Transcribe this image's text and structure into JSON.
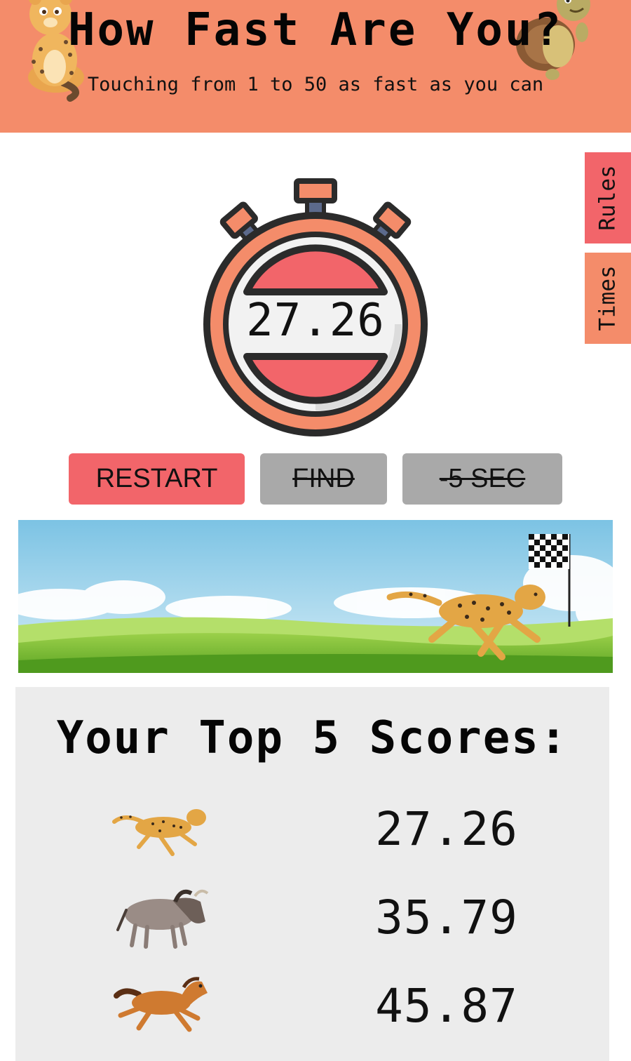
{
  "header": {
    "title": "How Fast Are You?",
    "subtitle": "Touching from 1 to 50 as fast as you can"
  },
  "side_tabs": {
    "rules": "Rules",
    "times": "Times"
  },
  "timer": {
    "value": "27.26"
  },
  "buttons": {
    "restart": "RESTART",
    "find": "FIND",
    "five_sec": "-5 SEC"
  },
  "scores": {
    "title": "Your Top 5 Scores:",
    "rows": [
      {
        "animal": "cheetah",
        "value": "27.26"
      },
      {
        "animal": "wildebeest",
        "value": "35.79"
      },
      {
        "animal": "horse",
        "value": "45.87"
      }
    ]
  },
  "colors": {
    "header_bg": "#f48c6a",
    "accent_red": "#f2656a",
    "disabled_gray": "#a9a9a9",
    "panel_bg": "#ececec"
  },
  "icons": {
    "left_mascot": "leopard-cub-icon",
    "right_mascot": "turtle-icon",
    "stopwatch": "stopwatch-icon",
    "banner": "cheetah-race-banner",
    "flag": "checkered-flag-icon"
  }
}
